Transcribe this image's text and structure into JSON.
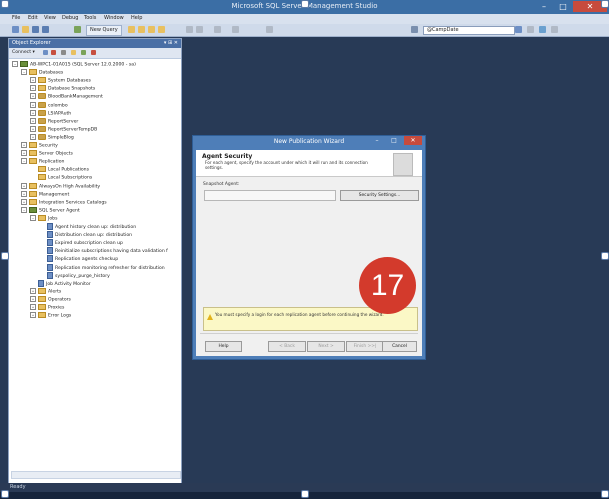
{
  "app": {
    "title": "Microsoft SQL Server Management Studio",
    "controls": {
      "minimize": "–",
      "maximize": "□",
      "close": "✕"
    }
  },
  "menu": [
    "File",
    "Edit",
    "View",
    "Debug",
    "Tools",
    "Window",
    "Help"
  ],
  "toolbar": {
    "new_query": "New Query",
    "database": "@CampDate"
  },
  "object_explorer": {
    "title": "Object Explorer",
    "pin": "▾ ⊞ ✕",
    "connect": "Connect ▾",
    "tree": [
      {
        "label": "AB-WPC1-01A015 (SQL Server 12.0.2000 - sa)",
        "icon": "server-icon",
        "level": 0,
        "exp": "−"
      },
      {
        "label": "Databases",
        "icon": "folder-icon",
        "level": 1,
        "exp": "−"
      },
      {
        "label": "System Databases",
        "icon": "folder-icon",
        "level": 2,
        "exp": "+"
      },
      {
        "label": "Database Snapshots",
        "icon": "folder-icon",
        "level": 2,
        "exp": "+"
      },
      {
        "label": "BloodBankManagement",
        "icon": "database-icon",
        "level": 2,
        "exp": "+"
      },
      {
        "label": "colombo",
        "icon": "database-icon",
        "level": 2,
        "exp": "+"
      },
      {
        "label": "LSIAPAuth",
        "icon": "database-icon",
        "level": 2,
        "exp": "+"
      },
      {
        "label": "ReportServer",
        "icon": "database-icon",
        "level": 2,
        "exp": "+"
      },
      {
        "label": "ReportServerTempDB",
        "icon": "database-icon",
        "level": 2,
        "exp": "+"
      },
      {
        "label": "SimpleBlog",
        "icon": "database-icon",
        "level": 2,
        "exp": "+"
      },
      {
        "label": "Security",
        "icon": "folder-icon",
        "level": 1,
        "exp": "+"
      },
      {
        "label": "Server Objects",
        "icon": "folder-icon",
        "level": 1,
        "exp": "+"
      },
      {
        "label": "Replication",
        "icon": "folder-icon",
        "level": 1,
        "exp": "−"
      },
      {
        "label": "Local Publications",
        "icon": "folder-icon",
        "level": 2,
        "exp": ""
      },
      {
        "label": "Local Subscriptions",
        "icon": "folder-icon",
        "level": 2,
        "exp": ""
      },
      {
        "label": "AlwaysOn High Availability",
        "icon": "folder-icon",
        "level": 1,
        "exp": "+"
      },
      {
        "label": "Management",
        "icon": "folder-icon",
        "level": 1,
        "exp": "+"
      },
      {
        "label": "Integration Services Catalogs",
        "icon": "folder-icon",
        "level": 1,
        "exp": "+"
      },
      {
        "label": "SQL Server Agent",
        "icon": "agent-icon",
        "level": 1,
        "exp": "−"
      },
      {
        "label": "Jobs",
        "icon": "folder-icon",
        "level": 2,
        "exp": "−"
      },
      {
        "label": "Agent history clean up: distribution",
        "icon": "job-icon",
        "level": 3,
        "exp": ""
      },
      {
        "label": "Distribution clean up: distribution",
        "icon": "job-icon",
        "level": 3,
        "exp": ""
      },
      {
        "label": "Expired subscription clean up",
        "icon": "job-icon",
        "level": 3,
        "exp": ""
      },
      {
        "label": "Reinitialize subscriptions having data validation f",
        "icon": "job-icon",
        "level": 3,
        "exp": ""
      },
      {
        "label": "Replication agents checkup",
        "icon": "job-icon",
        "level": 3,
        "exp": ""
      },
      {
        "label": "Replication monitoring refresher for distribution",
        "icon": "job-icon",
        "level": 3,
        "exp": ""
      },
      {
        "label": "syspolicy_purge_history",
        "icon": "job-icon",
        "level": 3,
        "exp": ""
      },
      {
        "label": "Job Activity Monitor",
        "icon": "monitor-icon",
        "level": 2,
        "exp": ""
      },
      {
        "label": "Alerts",
        "icon": "folder-icon",
        "level": 2,
        "exp": "+"
      },
      {
        "label": "Operators",
        "icon": "folder-icon",
        "level": 2,
        "exp": "+"
      },
      {
        "label": "Proxies",
        "icon": "folder-icon",
        "level": 2,
        "exp": "+"
      },
      {
        "label": "Error Logs",
        "icon": "folder-icon",
        "level": 2,
        "exp": "+"
      }
    ]
  },
  "status": "Ready",
  "dialog": {
    "title": "New Publication Wizard",
    "heading": "Agent Security",
    "description": "For each agent, specify the account under which it will run and its connection settings.",
    "snapshot_label": "Snapshot Agent:",
    "security_button": "Security Settings...",
    "warning": "You must specify a login for each replication agent before continuing the wizard.",
    "buttons": {
      "help": "Help",
      "back": "< Back",
      "next": "Next >",
      "finish": "Finish >>|",
      "cancel": "Cancel"
    }
  },
  "step_badge": "17",
  "colors": {
    "accent": "#3b6ea5",
    "desktop": "#283a56",
    "badge": "#d33a2c"
  }
}
